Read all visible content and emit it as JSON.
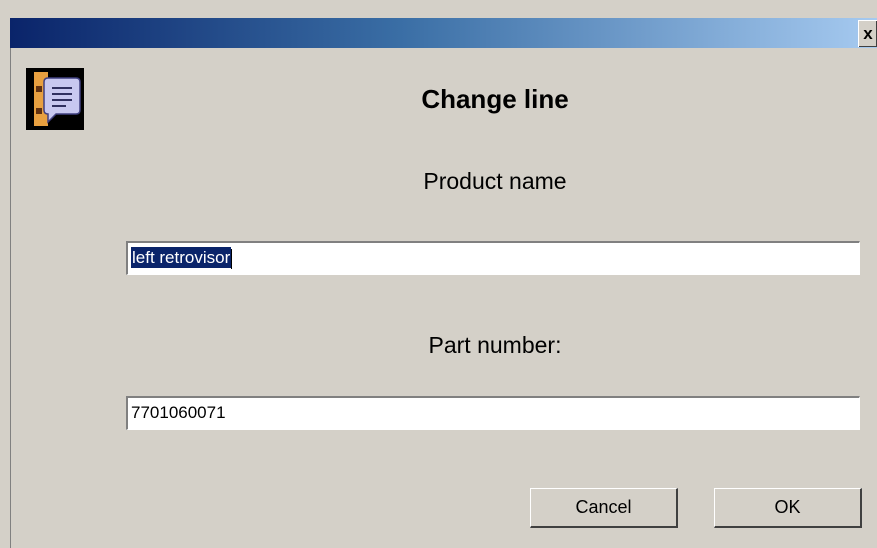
{
  "window": {
    "close_label": "x"
  },
  "dialog": {
    "icon": "dialog-message-icon",
    "title": "Change line"
  },
  "fields": {
    "product_name": {
      "label": "Product name",
      "value": "left retrovisor",
      "selected": true
    },
    "part_number": {
      "label": "Part number:",
      "value": "7701060071"
    }
  },
  "buttons": {
    "cancel": "Cancel",
    "ok": "OK"
  },
  "colors": {
    "titlebar_start": "#0a246a",
    "titlebar_end": "#a6caf0",
    "window_bg": "#d4d0c8",
    "selection_bg": "#0a246a"
  }
}
